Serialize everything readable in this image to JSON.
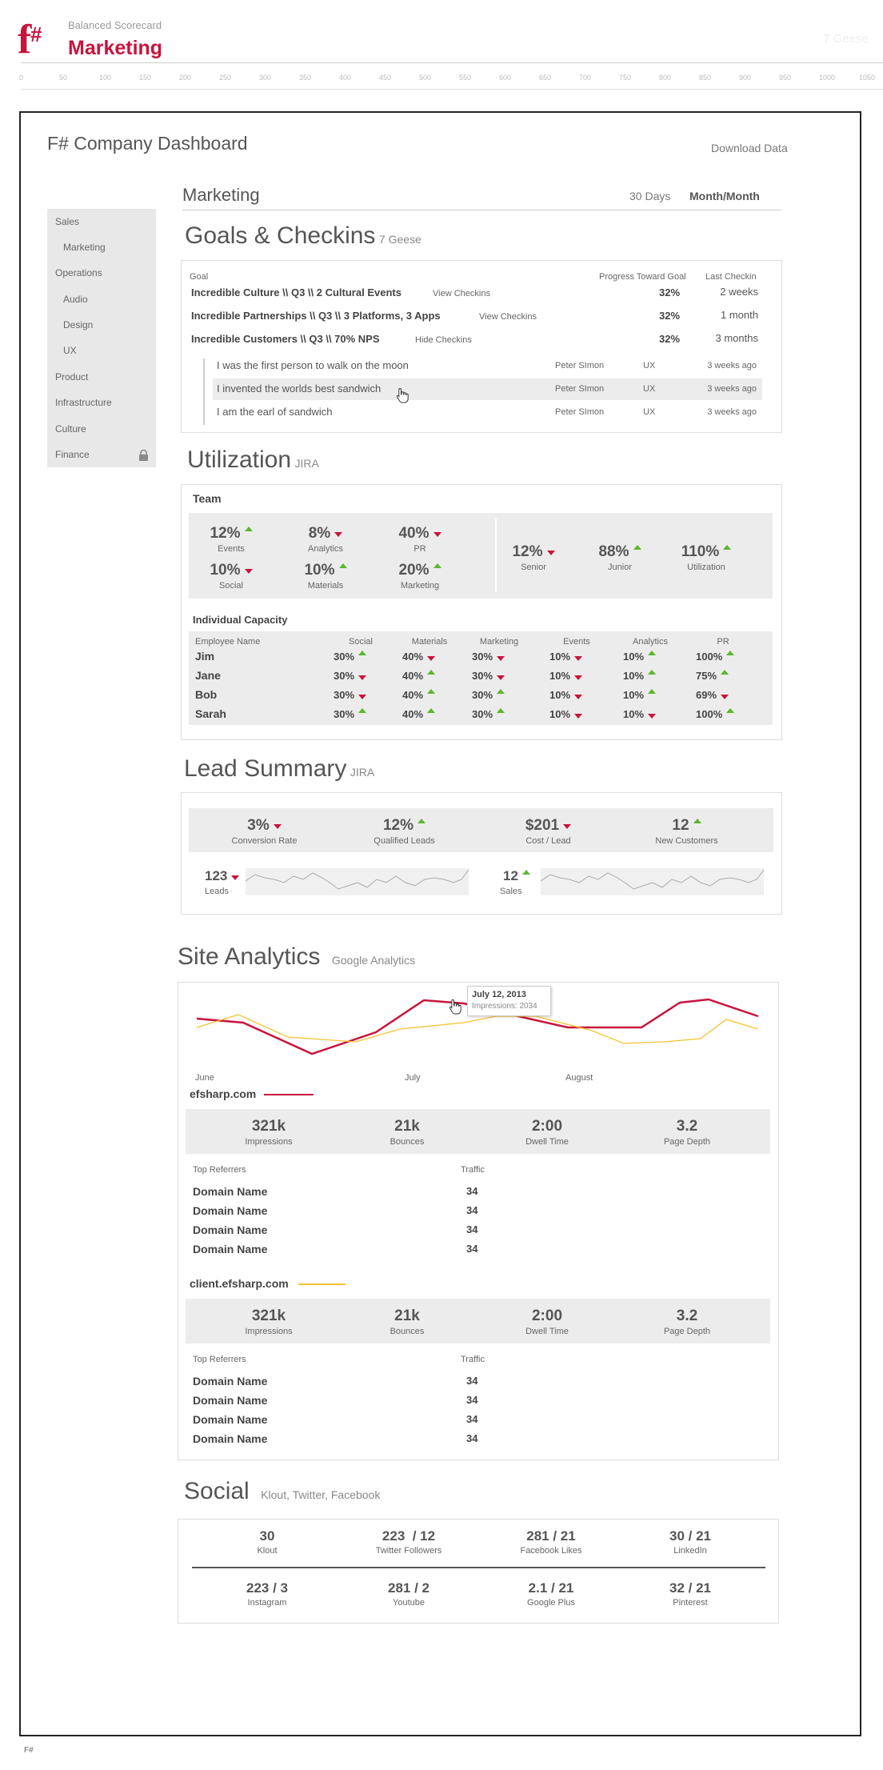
{
  "header": {
    "app_subtitle": "Balanced Scorecard",
    "app_title": "Marketing",
    "right_text": "7 Geese",
    "ruler": [
      "0",
      "50",
      "100",
      "150",
      "200",
      "250",
      "300",
      "350",
      "400",
      "450",
      "500",
      "550",
      "600",
      "650",
      "700",
      "750",
      "800",
      "850",
      "900",
      "950",
      "1000",
      "1050"
    ]
  },
  "dashboard": {
    "title": "F# Company Dashboard",
    "download": "Download Data"
  },
  "sidebar": {
    "items": [
      "Sales",
      "Marketing",
      "Operations",
      "Audio",
      "Design",
      "UX",
      "Product",
      "Infrastructure",
      "Culture",
      "Finance"
    ]
  },
  "section": {
    "title": "Marketing",
    "range_30": "30 Days",
    "range_mm": "Month/Month"
  },
  "goals": {
    "title": "Goals & Checkins",
    "source": "7 Geese",
    "col_goal": "Goal",
    "col_progress": "Progress Toward Goal",
    "col_last": "Last Checkin",
    "rows": [
      {
        "name": "Incredible Culture \\\\ Q3 \\\\ 2 Cultural Events",
        "link": "View Checkins",
        "progress": "32%",
        "last": "2 weeks"
      },
      {
        "name": "Incredible Partnerships \\\\ Q3 \\\\ 3 Platforms, 3 Apps",
        "link": "View Checkins",
        "progress": "32%",
        "last": "1 month"
      },
      {
        "name": "Incredible Customers \\\\ Q3 \\\\ 70% NPS",
        "link": "Hide Checkins",
        "progress": "32%",
        "last": "3 months"
      }
    ],
    "checkins": [
      {
        "text": "I was the first person to walk on the moon",
        "person": "Peter SImon",
        "team": "UX",
        "when": "3 weeks ago"
      },
      {
        "text": "I invented the worlds best sandwich",
        "person": "Peter SImon",
        "team": "UX",
        "when": "3 weeks ago"
      },
      {
        "text": "I am the earl of sandwich",
        "person": "Peter SImon",
        "team": "UX",
        "when": "3 weeks ago"
      }
    ]
  },
  "utilization": {
    "title": "Utilization",
    "source": "JIRA",
    "team_label": "Team",
    "team_stats": [
      {
        "value": "12%",
        "label": "Events",
        "trend": "up"
      },
      {
        "value": "8%",
        "label": "Analytics",
        "trend": "down"
      },
      {
        "value": "40%",
        "label": "PR",
        "trend": "down"
      },
      {
        "value": "10%",
        "label": "Social",
        "trend": "down"
      },
      {
        "value": "10%",
        "label": "Materials",
        "trend": "up"
      },
      {
        "value": "20%",
        "label": "Marketing",
        "trend": "up"
      }
    ],
    "level_stats": [
      {
        "value": "12%",
        "label": "Senior",
        "trend": "down"
      },
      {
        "value": "88%",
        "label": "Junior",
        "trend": "up"
      },
      {
        "value": "110%",
        "label": "Utilization",
        "trend": "up"
      }
    ],
    "capacity_label": "Individual Capacity",
    "capacity_headers": [
      "Employee Name",
      "Social",
      "Materials",
      "Marketing",
      "Events",
      "Analytics",
      "PR"
    ],
    "capacity_rows": [
      {
        "name": "Jim",
        "cells": [
          [
            "30%",
            "up"
          ],
          [
            "40%",
            "dn"
          ],
          [
            "30%",
            "dn"
          ],
          [
            "10%",
            "dn"
          ],
          [
            "10%",
            "up"
          ],
          [
            "100%",
            "up"
          ]
        ]
      },
      {
        "name": "Jane",
        "cells": [
          [
            "30%",
            "dn"
          ],
          [
            "40%",
            "up"
          ],
          [
            "30%",
            "dn"
          ],
          [
            "10%",
            "dn"
          ],
          [
            "10%",
            "up"
          ],
          [
            "75%",
            "up"
          ]
        ]
      },
      {
        "name": "Bob",
        "cells": [
          [
            "30%",
            "dn"
          ],
          [
            "40%",
            "up"
          ],
          [
            "30%",
            "up"
          ],
          [
            "10%",
            "dn"
          ],
          [
            "10%",
            "up"
          ],
          [
            "69%",
            "dn"
          ]
        ]
      },
      {
        "name": "Sarah",
        "cells": [
          [
            "30%",
            "up"
          ],
          [
            "40%",
            "up"
          ],
          [
            "30%",
            "up"
          ],
          [
            "10%",
            "dn"
          ],
          [
            "10%",
            "dn"
          ],
          [
            "100%",
            "up"
          ]
        ]
      }
    ]
  },
  "lead": {
    "title": "Lead Summary",
    "source": "JIRA",
    "stats": [
      {
        "value": "3%",
        "label": "Conversion Rate",
        "trend": "dn"
      },
      {
        "value": "12%",
        "label": "Qualified Leads",
        "trend": "up"
      },
      {
        "value": "$201",
        "label": "Cost / Lead",
        "trend": "dn"
      },
      {
        "value": "12",
        "label": "New Customers",
        "trend": "up"
      }
    ],
    "leads_value": "123",
    "leads_label": "Leads",
    "sales_value": "12",
    "sales_label": "Sales"
  },
  "analytics": {
    "title": "Site Analytics",
    "source": "Google Analytics",
    "tooltip_date": "July 12, 2013",
    "tooltip_value": "Impressions: 2034",
    "months": [
      "June",
      "July",
      "August"
    ],
    "colors": {
      "efsharp": "#c8143c",
      "client": "#f5c330"
    },
    "sites": [
      {
        "name": "efsharp.com",
        "stats": [
          {
            "value": "321k",
            "label": "Impressions"
          },
          {
            "value": "21k",
            "label": "Bounces"
          },
          {
            "value": "2:00",
            "label": "Dwell Time"
          },
          {
            "value": "3.2",
            "label": "Page Depth"
          }
        ],
        "col_ref": "Top Referrers",
        "col_traffic": "Traffic",
        "referrers": [
          {
            "name": "Domain Name",
            "traffic": "34"
          },
          {
            "name": "Domain Name",
            "traffic": "34"
          },
          {
            "name": "Domain Name",
            "traffic": "34"
          },
          {
            "name": "Domain Name",
            "traffic": "34"
          }
        ]
      },
      {
        "name": "client.efsharp.com",
        "stats": [
          {
            "value": "321k",
            "label": "Impressions"
          },
          {
            "value": "21k",
            "label": "Bounces"
          },
          {
            "value": "2:00",
            "label": "Dwell Time"
          },
          {
            "value": "3.2",
            "label": "Page Depth"
          }
        ],
        "col_ref": "Top Referrers",
        "col_traffic": "Traffic",
        "referrers": [
          {
            "name": "Domain Name",
            "traffic": "34"
          },
          {
            "name": "Domain Name",
            "traffic": "34"
          },
          {
            "name": "Domain Name",
            "traffic": "34"
          },
          {
            "name": "Domain Name",
            "traffic": "34"
          }
        ]
      }
    ]
  },
  "social": {
    "title": "Social",
    "source": "Klout, Twitter, Facebook",
    "row1": [
      {
        "value": "30",
        "label": "Klout"
      },
      {
        "value": "223  / 12",
        "label": "Twitter Followers"
      },
      {
        "value": "281 / 21",
        "label": "Facebook Likes"
      },
      {
        "value": "30 / 21",
        "label": "LinkedIn"
      }
    ],
    "row2": [
      {
        "value": "223 / 3",
        "label": "Instagram"
      },
      {
        "value": "281 / 2",
        "label": "Youtube"
      },
      {
        "value": "2.1 / 21",
        "label": "Google Plus"
      },
      {
        "value": "32 / 21",
        "label": "Pinterest"
      }
    ]
  },
  "footer": "F#"
}
